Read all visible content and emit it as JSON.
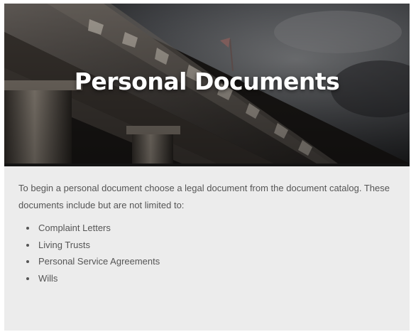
{
  "hero": {
    "title": "Personal Documents",
    "background_image": "courthouse-columns-photo"
  },
  "content": {
    "intro": "To begin a personal document choose a legal document from the document catalog. These documents include but are not limited to:",
    "documents": [
      "Complaint Letters",
      "Living Trusts",
      "Personal Service Agreements",
      "Wills"
    ]
  },
  "colors": {
    "card_background": "#ececec",
    "body_text": "#555555",
    "title_text": "#ffffff",
    "divider": "#141414"
  }
}
